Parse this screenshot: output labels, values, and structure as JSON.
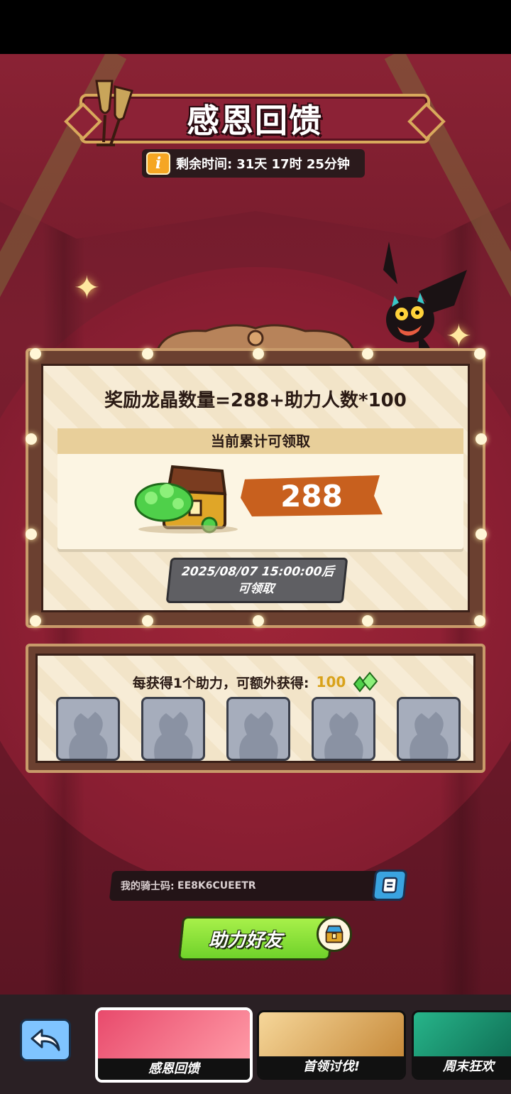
{
  "event": {
    "title": "感恩回馈",
    "timer_label": "剩余时间:",
    "timer_value": "31天 17时 25分钟"
  },
  "reward": {
    "formula": "奖励龙晶数量=288+助力人数*100",
    "claim_header": "当前累计可领取",
    "amount": "288",
    "claim_after_line1": "2025/08/07 15:00:00后",
    "claim_after_line2": "可领取"
  },
  "helpers": {
    "bonus_text": "每获得1个助力，可额外获得:",
    "bonus_value": "100",
    "slots": 5
  },
  "code": {
    "label": "我的骑士码:",
    "value": "EE8K6CUEETR"
  },
  "actions": {
    "help_friend": "助力好友"
  },
  "nav": {
    "tabs": [
      {
        "label": "感恩回馈"
      },
      {
        "label": "首领讨伐!"
      },
      {
        "label": "周末狂欢"
      }
    ]
  },
  "colors": {
    "background": "#7a1e2f",
    "accent_orange": "#c8601e",
    "button_green": "#6fd22a",
    "gold": "#d9a21a"
  },
  "icons": [
    "info-icon",
    "champagne-glasses-icon",
    "dragon-mascot-icon",
    "treasure-chest-icon",
    "gem-icon",
    "copy-icon",
    "back-arrow-icon",
    "sparkle-icon",
    "silhouette-icon"
  ]
}
